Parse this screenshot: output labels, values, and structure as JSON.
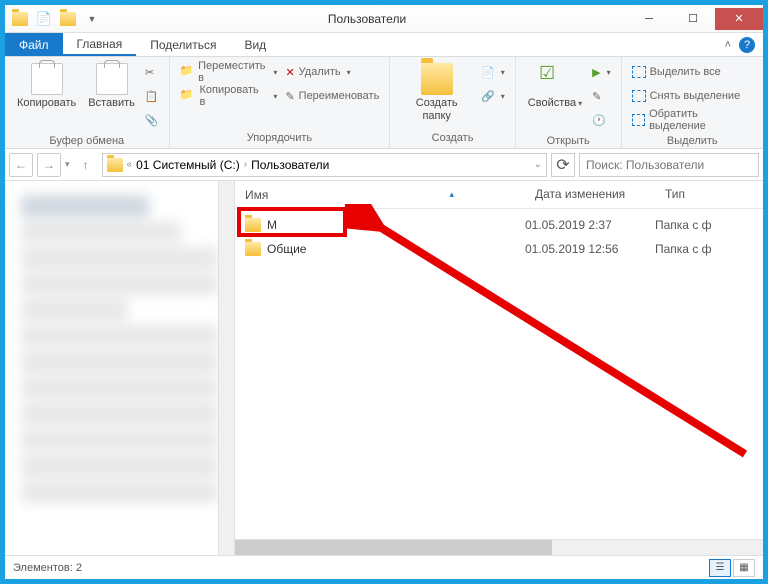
{
  "title": "Пользователи",
  "tabs": {
    "file": "Файл",
    "home": "Главная",
    "share": "Поделиться",
    "view": "Вид"
  },
  "ribbon": {
    "clipboard": {
      "copy": "Копировать",
      "paste": "Вставить",
      "label": "Буфер обмена"
    },
    "organize": {
      "move": "Переместить в",
      "copy_to": "Копировать в",
      "delete": "Удалить",
      "rename": "Переименовать",
      "label": "Упорядочить"
    },
    "new": {
      "folder": "Создать папку",
      "label": "Создать"
    },
    "open": {
      "properties": "Свойства",
      "label": "Открыть"
    },
    "select": {
      "all": "Выделить все",
      "none": "Снять выделение",
      "invert": "Обратить выделение",
      "label": "Выделить"
    }
  },
  "breadcrumb": {
    "drive": "01 Системный (C:)",
    "folder": "Пользователи"
  },
  "search_placeholder": "Поиск: Пользователи",
  "columns": {
    "name": "Имя",
    "date": "Дата изменения",
    "type": "Тип"
  },
  "files": [
    {
      "name": "М",
      "name_obscured": "    ",
      "date": "01.05.2019 2:37",
      "type": "Папка с ф"
    },
    {
      "name": "Общие",
      "date": "01.05.2019 12:56",
      "type": "Папка с ф"
    }
  ],
  "status": "Элементов: 2"
}
